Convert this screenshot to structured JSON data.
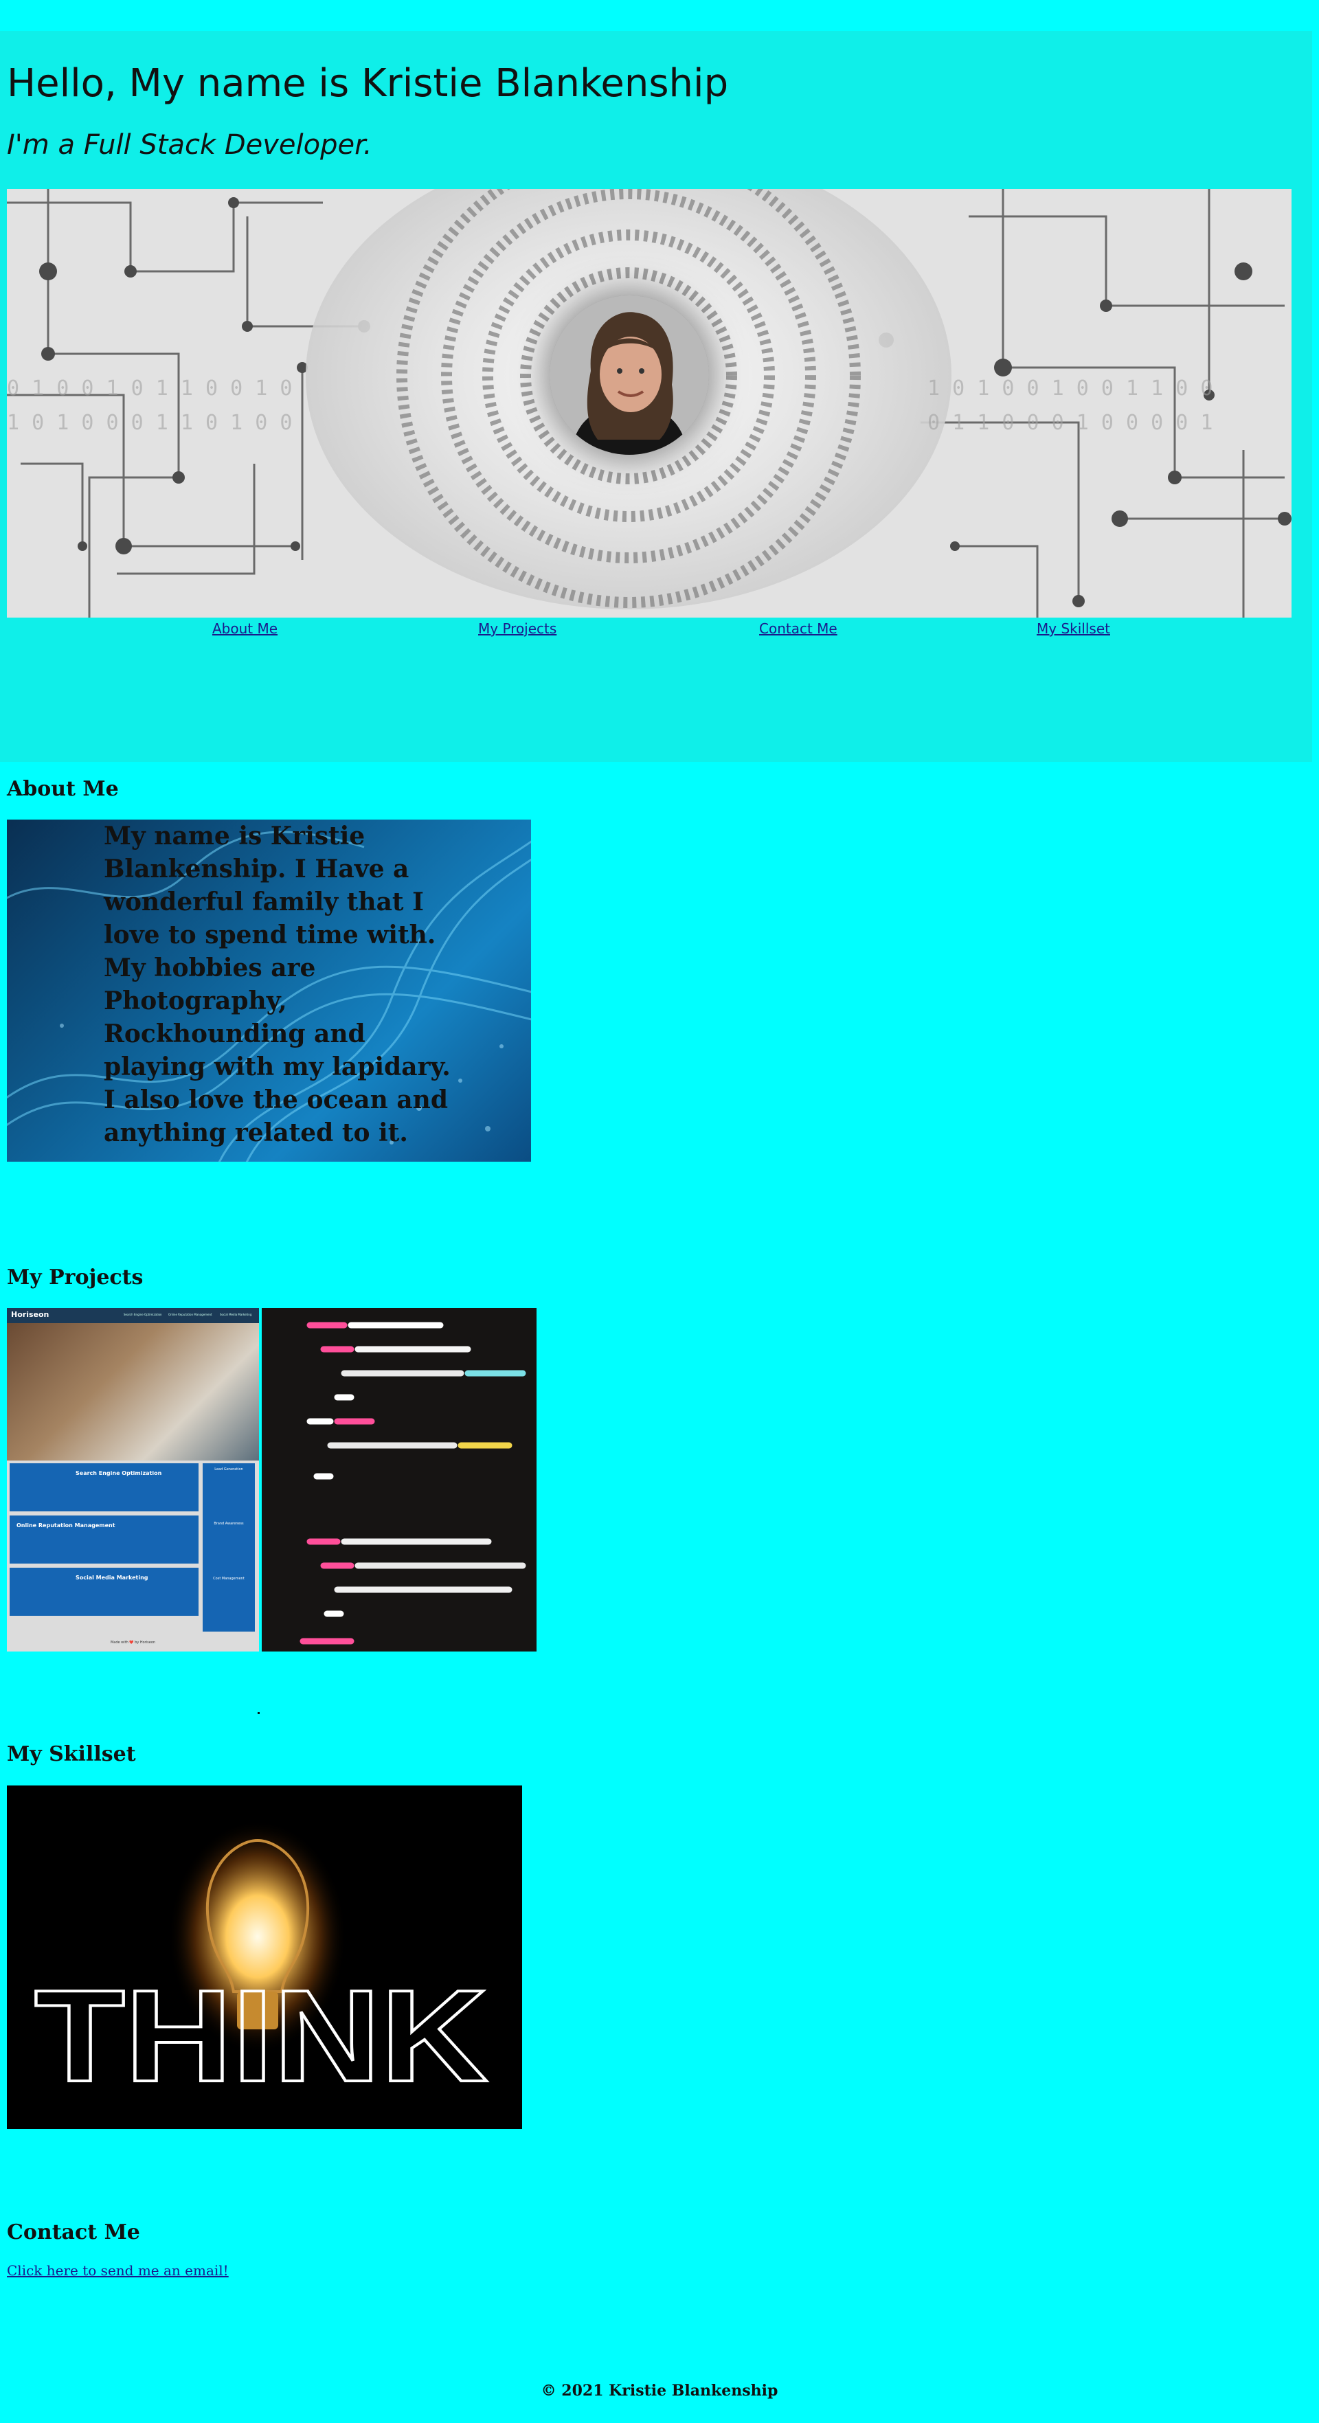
{
  "header": {
    "title": "Hello, My name is Kristie Blankenship",
    "subtitle": "I'm a Full Stack Developer."
  },
  "nav": {
    "items": [
      {
        "label": "About Me"
      },
      {
        "label": "My Projects"
      },
      {
        "label": "Contact Me"
      },
      {
        "label": "My Skillset"
      }
    ]
  },
  "about": {
    "heading": "About Me",
    "text": "My name is Kristie Blankenship. I Have a wonderful family that I love to spend time with. My hobbies are Photography, Rockhounding and playing with my lapidary. I also love the ocean and anything related to it."
  },
  "projects": {
    "heading": "My Projects",
    "horiseon": {
      "brand": "Horiseon",
      "nav_items": [
        "Search Engine Optimization",
        "Online Reputation Management",
        "Social Media Marketing"
      ],
      "cards": [
        "Search Engine Optimization",
        "Online Reputation Management",
        "Social Media Marketing"
      ],
      "sidebar": [
        "Lead Generation",
        "Brand Awareness",
        "Cost Management"
      ],
      "footer": "Made with ❤️ by Horiseon"
    }
  },
  "skillset": {
    "heading": "My Skillset",
    "image_word": "THINK"
  },
  "contact": {
    "heading": "Contact Me",
    "link_text": "Click here to send me an email!"
  },
  "footer": {
    "text": "© 2021 Kristie Blankenship"
  },
  "colors": {
    "page_bg": "#00ffff",
    "header_bg": "#0fefe9",
    "link": "#1a1a8c"
  }
}
